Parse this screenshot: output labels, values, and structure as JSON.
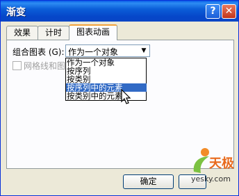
{
  "window": {
    "title": "渐变",
    "help_icon": "question-mark",
    "close_icon": "x"
  },
  "tabs": [
    {
      "label": "效果",
      "active": false
    },
    {
      "label": "计时",
      "active": false
    },
    {
      "label": "图表动画",
      "active": true
    }
  ],
  "panel": {
    "group_chart_label": "组合图表 (G):",
    "combo_value": "作为一个对象",
    "checkbox_label": "网格线和图",
    "checkbox_checked": false
  },
  "dropdown": {
    "items": [
      "作为一个对象",
      "按序列",
      "按类别",
      "按序列中的元素",
      "按类别中的元素"
    ],
    "selected_index": 3
  },
  "buttons": {
    "ok_label": "确定"
  },
  "watermark": {
    "brand": "天极",
    "url": "yesky.com"
  },
  "colors": {
    "titlebar": "#0a5ce8",
    "selection": "#316ac5",
    "tab_accent": "#f2a23a",
    "dialog_bg": "#ece9d8"
  }
}
